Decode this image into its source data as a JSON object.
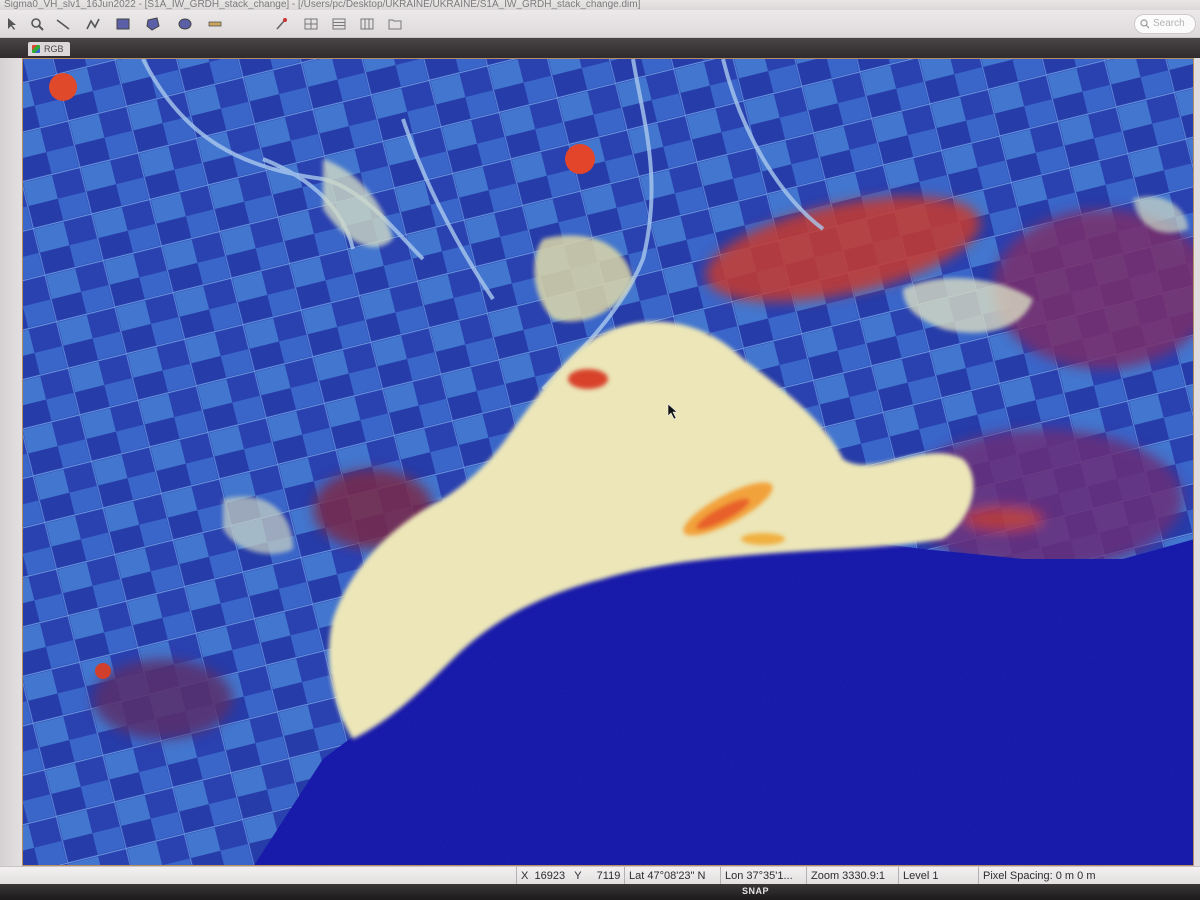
{
  "window": {
    "title": "Sigma0_VH_slv1_16Jun2022 - [S1A_IW_GRDH_stack_change] - [/Users/pc/Desktop/UKRAINE/UKRAINE/S1A_IW_GRDH_stack_change.dim]"
  },
  "toolbar": {
    "search_placeholder": "Search",
    "tools": [
      {
        "name": "select-tool",
        "icon": "arrow-cursor-icon"
      },
      {
        "name": "zoom-tool",
        "icon": "magnifier-icon"
      },
      {
        "name": "draw-line-tool",
        "icon": "line-icon"
      },
      {
        "name": "draw-polyline-tool",
        "icon": "polyline-icon"
      },
      {
        "name": "draw-rectangle-tool",
        "icon": "rectangle-icon"
      },
      {
        "name": "draw-polygon-tool",
        "icon": "polygon-icon"
      },
      {
        "name": "draw-ellipse-tool",
        "icon": "ellipse-icon"
      },
      {
        "name": "range-finder-tool",
        "icon": "ruler-icon"
      },
      {
        "name": "pin-tool",
        "icon": "pin-icon"
      },
      {
        "name": "tile-evenly-button",
        "icon": "tile-icon"
      },
      {
        "name": "tile-horizontal-button",
        "icon": "tile-horizontal-icon"
      },
      {
        "name": "tile-vertical-button",
        "icon": "tile-vertical-icon"
      },
      {
        "name": "folder-button",
        "icon": "folder-icon"
      }
    ]
  },
  "tab": {
    "label": "RGB",
    "icon": "rgb-image-icon"
  },
  "status": {
    "x_label": "X",
    "x_value": "16923",
    "y_label": "Y",
    "y_value": "7119",
    "lat": "Lat 47°08'23\" N",
    "lon": "Lon 37°35'1...",
    "zoom": "Zoom 3330.9:1",
    "level": "Level 1",
    "pixel_spacing": "Pixel Spacing: 0 m 0 m"
  },
  "dock": {
    "label": "SNAP"
  },
  "colors": {
    "land": "#2c49b9",
    "land_light": "#4d84d8",
    "sea": "#1414a6",
    "urban": "#eee9b8",
    "change_red": "#c8382a",
    "change_orange": "#f0a030"
  }
}
